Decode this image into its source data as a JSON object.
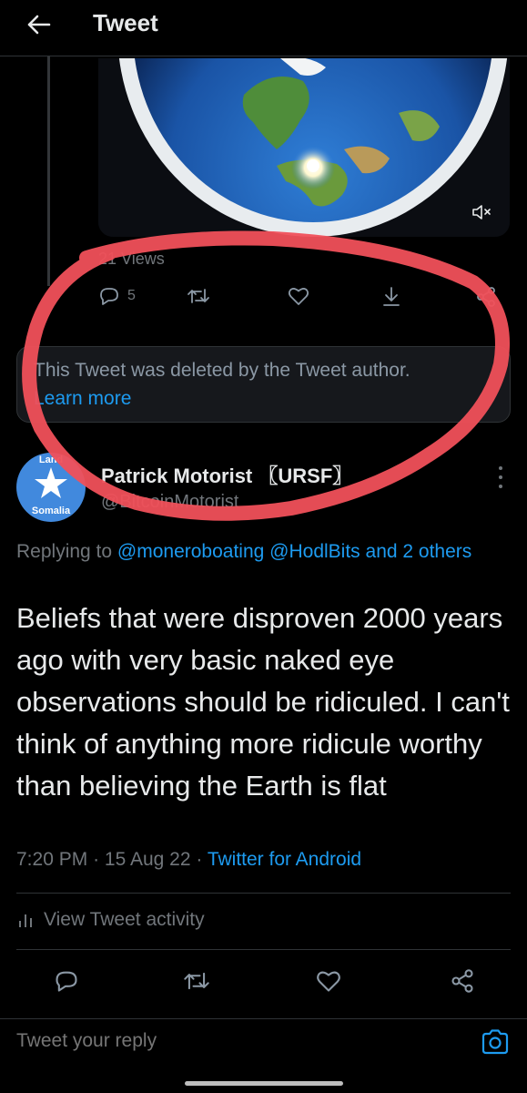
{
  "header": {
    "title": "Tweet"
  },
  "quoted": {
    "views": "21 Views",
    "reply_count": "5"
  },
  "deleted_notice": {
    "text": "This Tweet was deleted by the Tweet author.",
    "learn_more": "Learn more"
  },
  "author": {
    "avatar_top_text": "Land",
    "avatar_bottom_text": "Somalia",
    "name": "Patrick Motorist 〖URSF〗",
    "handle": "@BitcoinMotorist"
  },
  "tweet": {
    "replying_prefix": "Replying to ",
    "replying_mention_1": "@moneroboating",
    "replying_mention_2": "@HodlBits",
    "replying_suffix": "and 2 others",
    "text": "Beliefs that were disproven 2000 years ago with very basic naked eye observations should be ridiculed. I can't think of anything more ridicule worthy than believing the Earth is flat",
    "time": "7:20 PM",
    "date": "15 Aug 22",
    "separator": "·",
    "source": "Twitter for Android",
    "activity_label": "View Tweet activity"
  },
  "reply_bar": {
    "placeholder": "Tweet your reply"
  },
  "colors": {
    "background": "#000000",
    "accent": "#1d9bf0",
    "muted": "#71767b",
    "annotation_circle": "#f0505a"
  },
  "icons": {
    "back": "arrow-left-icon",
    "mute": "volume-mute-icon",
    "reply": "reply-icon",
    "retweet": "retweet-icon",
    "like": "heart-icon",
    "bookmark": "bookmark-download-icon",
    "share": "share-icon",
    "activity": "bar-chart-icon",
    "camera": "camera-icon",
    "more": "more-vertical-icon"
  }
}
